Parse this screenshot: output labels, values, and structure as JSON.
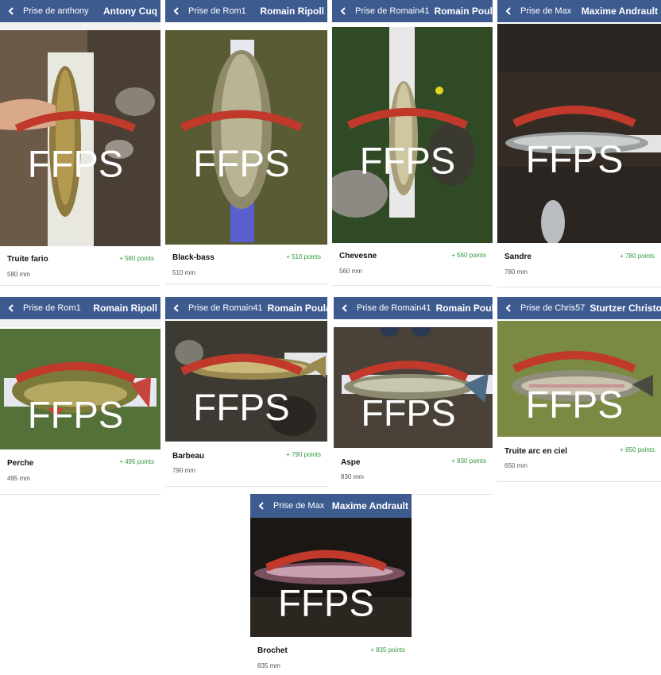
{
  "colors": {
    "header": "#3e5b90",
    "points": "#2e9a3f"
  },
  "icons": {
    "back": "chevron-left-icon",
    "logo": "ffps-logo"
  },
  "cards": [
    {
      "prise": "Prise de anthony",
      "name": "Antony Cuq",
      "species": "Truite fario",
      "points": "+ 580 points",
      "length": "580 mm",
      "logo_text": "FFPS"
    },
    {
      "prise": "Prise de Rom1",
      "name": "Romain Ripoll",
      "species": "Black-bass",
      "points": "+ 510 points",
      "length": "510 mm",
      "logo_text": "FFPS"
    },
    {
      "prise": "Prise de Romain41",
      "name": "Romain Poulain",
      "species": "Chevesne",
      "points": "+ 560 points",
      "length": "560 mm",
      "logo_text": "FFPS"
    },
    {
      "prise": "Prise de Max",
      "name": "Maxime Andrault",
      "species": "Sandre",
      "points": "+ 780 points",
      "length": "780 mm",
      "logo_text": "FFPS"
    },
    {
      "prise": "Prise de Rom1",
      "name": "Romain Ripoll",
      "species": "Perche",
      "points": "+ 495 points",
      "length": "495 mm",
      "logo_text": "FFPS"
    },
    {
      "prise": "Prise de Romain41",
      "name": "Romain Poulain",
      "species": "Barbeau",
      "points": "+ 790 points",
      "length": "790 mm",
      "logo_text": "FFPS"
    },
    {
      "prise": "Prise de Romain41",
      "name": "Romain Poulain",
      "species": "Aspe",
      "points": "+ 830 points",
      "length": "830 mm",
      "logo_text": "FFPS"
    },
    {
      "prise": "Prise de Chris57",
      "name": "Sturtzer Christophe",
      "species": "Truite arc en ciel",
      "points": "+ 650 points",
      "length": "650 mm",
      "logo_text": "FFPS"
    },
    {
      "prise": "Prise de Max",
      "name": "Maxime Andrault",
      "species": "Brochet",
      "points": "+ 835 points",
      "length": "835 mm",
      "logo_text": "FFPS"
    }
  ]
}
